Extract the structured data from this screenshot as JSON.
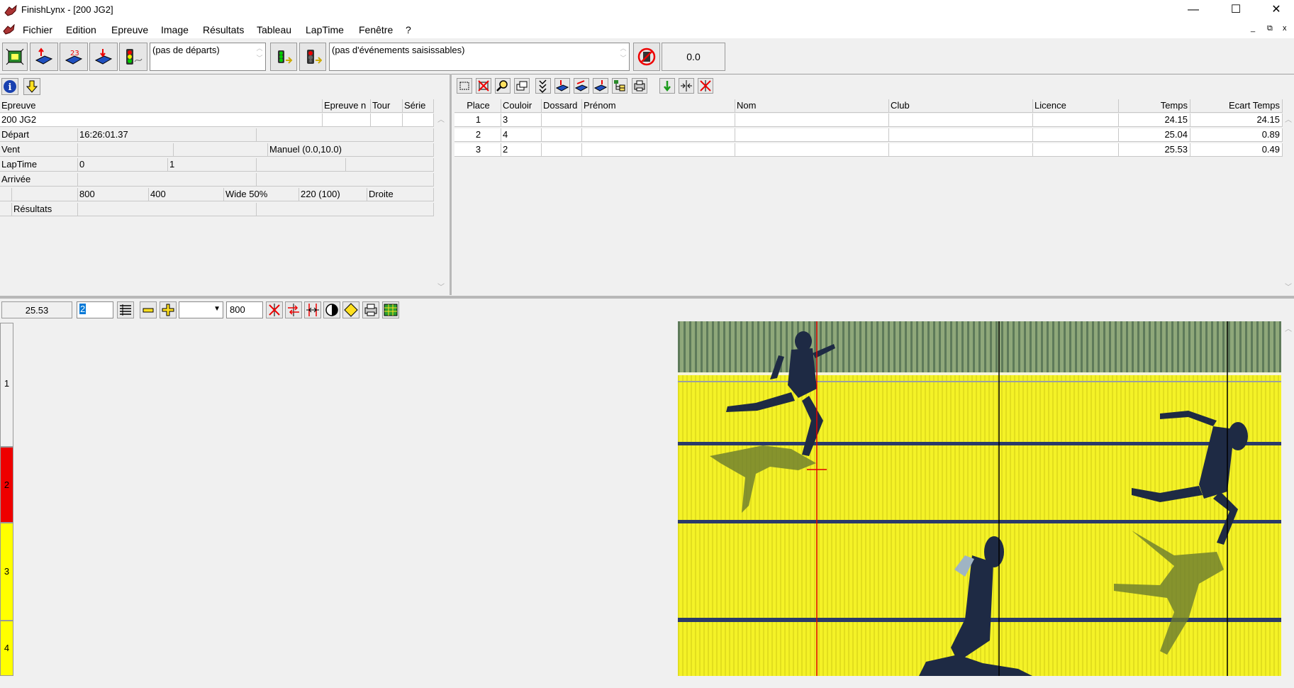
{
  "window": {
    "title": "FinishLynx - [200 JG2]",
    "controls": [
      "—",
      "☐",
      "✕"
    ],
    "mdi_controls": [
      "_",
      "⧉",
      "x"
    ]
  },
  "menu": [
    "Fichier",
    "Edition",
    "Epreuve",
    "Image",
    "Résultats",
    "Tableau",
    "LapTime",
    "Fenêtre",
    "?"
  ],
  "toolbar": {
    "departs": "(pas de départs)",
    "evenements": "(pas d'événements saisissables)",
    "time_display": "0.0"
  },
  "event_panel": {
    "headers": {
      "epreuve": "Epreuve",
      "epreuve_n": "Epreuve n",
      "tour": "Tour",
      "serie": "Série"
    },
    "event_name": "200 JG2",
    "depart_label": "Départ",
    "depart_value": "16:26:01.37",
    "vent_label": "Vent",
    "vent_value": "Manuel (0.0,10.0)",
    "laptime_label": "LapTime",
    "laptime_a": "0",
    "laptime_b": "1",
    "arrivee_label": "Arrivée",
    "settings": [
      "800",
      "400",
      "Wide 50%",
      "220  (100)",
      "Droite"
    ],
    "resultats_label": "Résultats"
  },
  "results": {
    "columns": [
      "Place",
      "Couloir",
      "Dossard",
      "Prénom",
      "Nom",
      "Club",
      "Licence",
      "Temps",
      "Ecart Temps"
    ],
    "rows": [
      {
        "place": "1",
        "couloir": "3",
        "dossard": "",
        "prenom": "",
        "nom": "",
        "club": "",
        "licence": "",
        "temps": "24.15",
        "ecart": "24.15"
      },
      {
        "place": "2",
        "couloir": "4",
        "dossard": "",
        "prenom": "",
        "nom": "",
        "club": "",
        "licence": "",
        "temps": "25.04",
        "ecart": "0.89"
      },
      {
        "place": "3",
        "couloir": "2",
        "dossard": "",
        "prenom": "",
        "nom": "",
        "club": "",
        "licence": "",
        "temps": "25.53",
        "ecart": "0.49"
      }
    ]
  },
  "image_toolbar": {
    "time": "25.53",
    "lane_field": "2",
    "density": "800"
  },
  "lanes": [
    {
      "label": "1",
      "color": "#f0f0f0"
    },
    {
      "label": "2",
      "color": "#ee0000"
    },
    {
      "label": "3",
      "color": "#ffff00"
    },
    {
      "label": "4",
      "color": "#ffff00"
    }
  ],
  "colors": {
    "accent_red": "#e00000",
    "track_yellow": "#f4f227",
    "lane_line": "#2a3a6a"
  }
}
